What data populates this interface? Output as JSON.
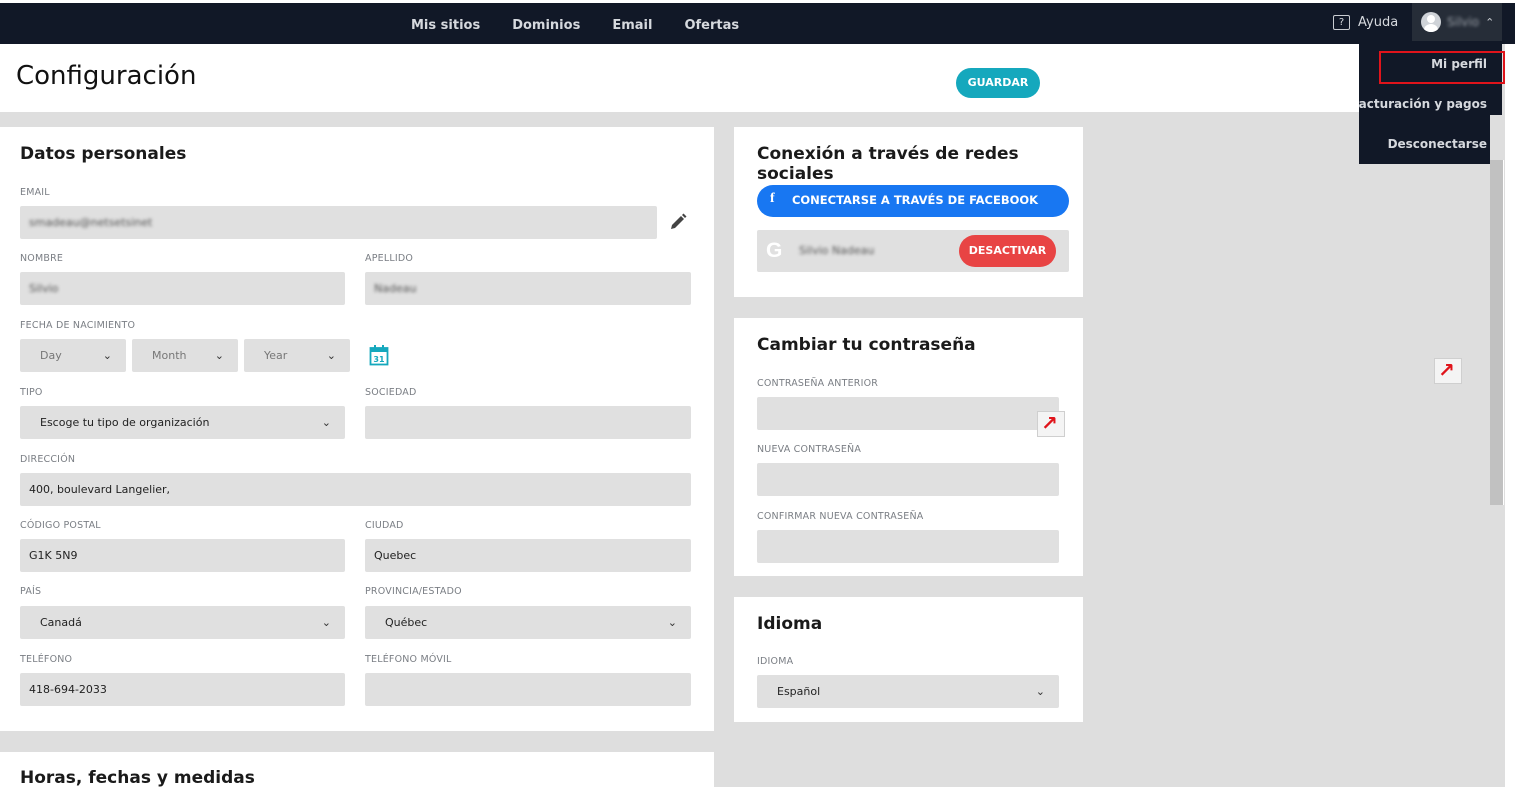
{
  "topbar": {
    "nav": [
      "Mis sitios",
      "Dominios",
      "Email",
      "Ofertas"
    ],
    "help": "Ayuda",
    "help_icon": "question-icon",
    "username": "Silvio"
  },
  "user_menu": {
    "items": [
      "Mi perfil",
      "Facturación y pagos",
      "Desconectarse"
    ],
    "highlighted": "Mi perfil",
    "highlight_color": "#e0141b"
  },
  "header": {
    "title": "Configuración",
    "save": "GUARDAR"
  },
  "personal": {
    "title": "Datos personales",
    "email_label": "EMAIL",
    "email_value": "smadeau@netsetsinet",
    "nombre_label": "NOMBRE",
    "nombre_value": "Silvio",
    "apellido_label": "APELLIDO",
    "apellido_value": "Nadeau",
    "birth_label": "FECHA DE NACIMIENTO",
    "day": "Day",
    "month": "Month",
    "year": "Year",
    "tipo_label": "TIPO",
    "tipo_value": "Escoge tu tipo de organización",
    "sociedad_label": "SOCIEDAD",
    "sociedad_value": "",
    "direccion_label": "DIRECCIÓN",
    "direccion_value": "400, boulevard Langelier,",
    "cp_label": "CÓDIGO POSTAL",
    "cp_value": "G1K 5N9",
    "ciudad_label": "CIUDAD",
    "ciudad_value": "Quebec",
    "pais_label": "PAÍS",
    "pais_value": "Canadá",
    "provincia_label": "PROVINCIA/ESTADO",
    "provincia_value": "Québec",
    "telefono_label": "TELÉFONO",
    "telefono_value": "418-694-2033",
    "movil_label": "TELÉFONO MÓVIL",
    "movil_value": ""
  },
  "social": {
    "title": "Conexión a través de redes sociales",
    "facebook_btn": "CONECTARSE A TRAVÉS DE FACEBOOK",
    "google_name": "Silvio Nadeau",
    "deactivate_btn": "DESACTIVAR",
    "facebook_color": "#1877f2",
    "deactivate_color": "#e84444"
  },
  "password": {
    "title": "Cambiar tu contraseña",
    "old_label": "CONTRASEÑA ANTERIOR",
    "new_label": "NUEVA CONTRASEÑA",
    "confirm_label": "CONFIRMAR NUEVA CONTRASEÑA"
  },
  "language": {
    "title": "Idioma",
    "label": "IDIOMA",
    "value": "Español"
  },
  "units": {
    "title": "Horas, fechas y medidas"
  },
  "colors": {
    "topbar": "#111827",
    "accent": "#15a8bd"
  }
}
